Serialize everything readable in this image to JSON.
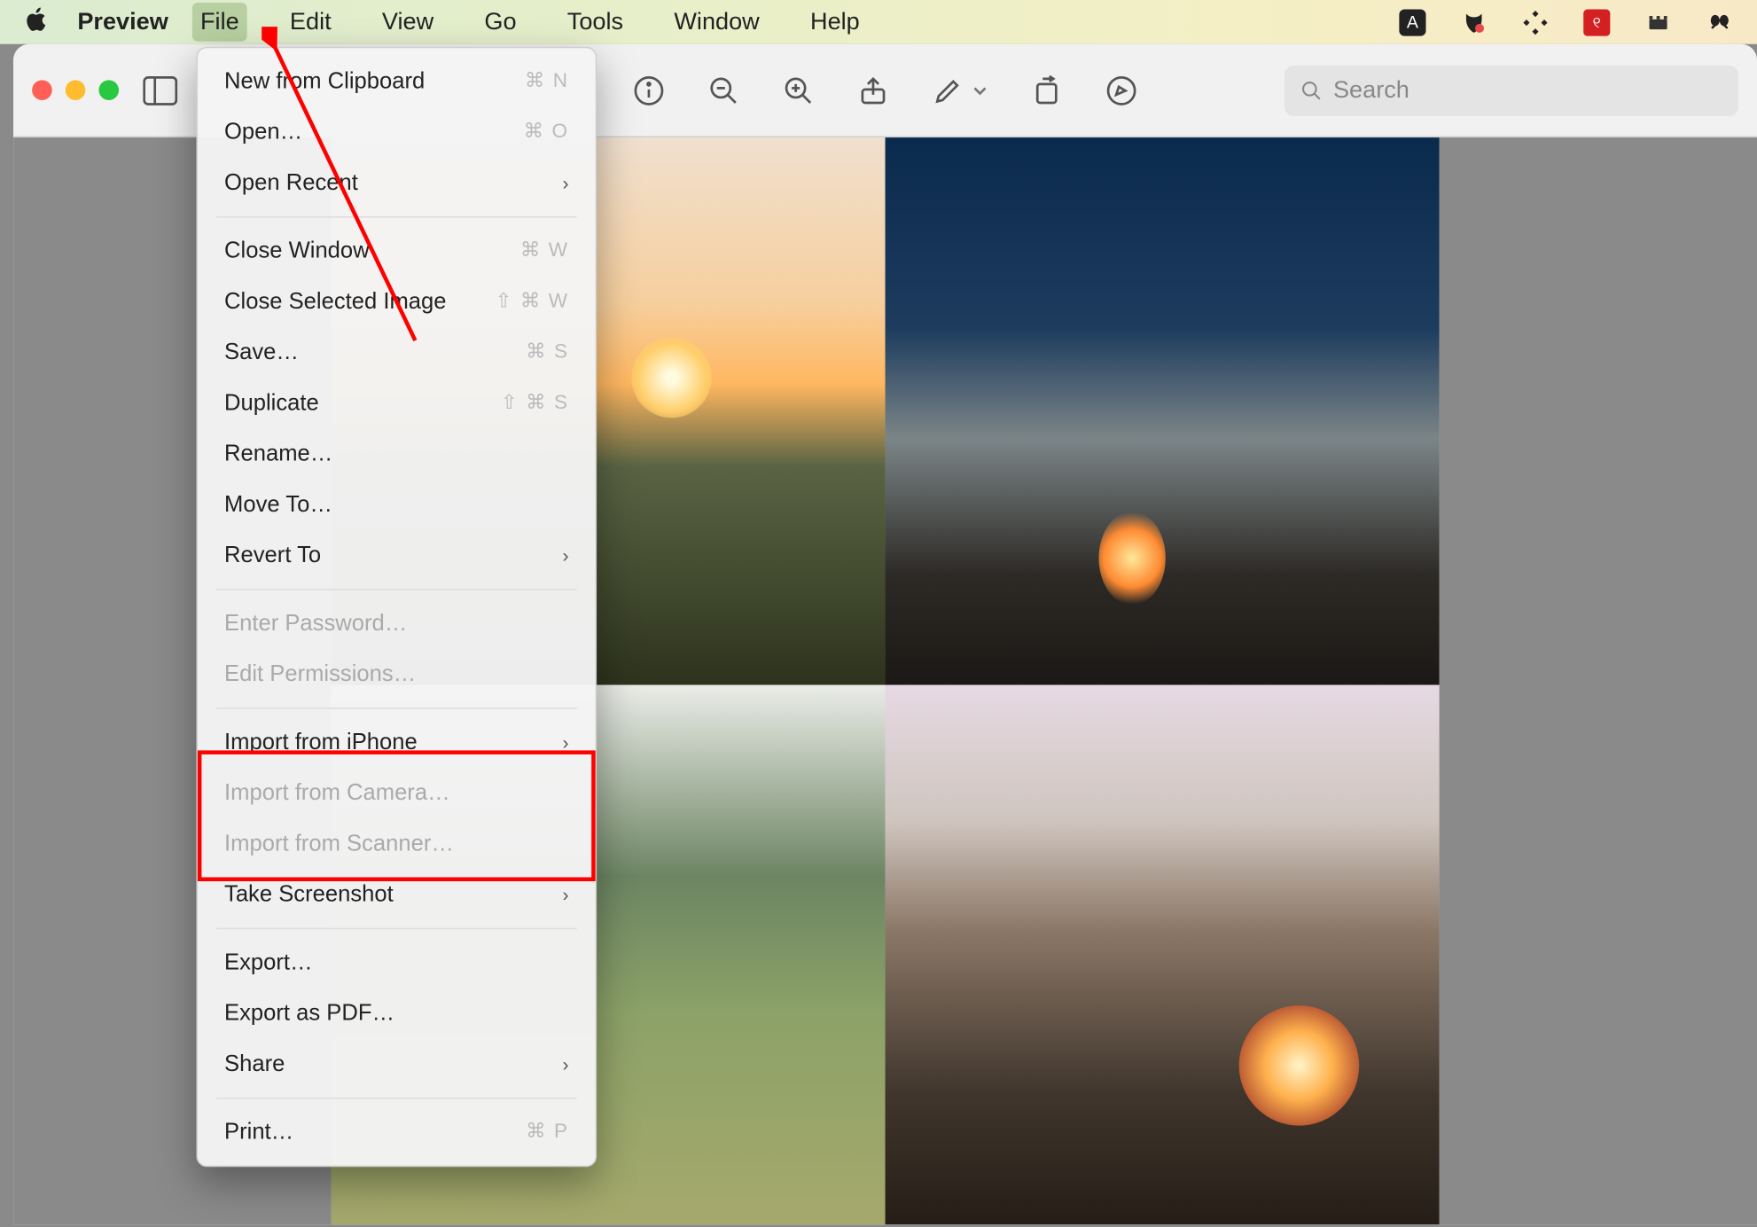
{
  "menubar": {
    "app_name": "Preview",
    "menus": [
      "File",
      "Edit",
      "View",
      "Go",
      "Tools",
      "Window",
      "Help"
    ]
  },
  "tray": {
    "icons": [
      "square-a-icon",
      "malware-icon",
      "cluster-icon",
      "red-square-icon",
      "boxes-icon",
      "binoculars-icon"
    ]
  },
  "toolbar": {
    "search_placeholder": "Search"
  },
  "menu": {
    "new_from_clipboard": "New from Clipboard",
    "new_shortcut": "⌘ N",
    "open": "Open…",
    "open_shortcut": "⌘ O",
    "open_recent": "Open Recent",
    "close_window": "Close Window",
    "close_window_shortcut": "⌘ W",
    "close_selected": "Close Selected Image",
    "close_selected_shortcut": "⇧ ⌘ W",
    "save": "Save…",
    "save_shortcut": "⌘ S",
    "duplicate": "Duplicate",
    "duplicate_shortcut": "⇧ ⌘ S",
    "rename": "Rename…",
    "move_to": "Move To…",
    "revert_to": "Revert To",
    "enter_password": "Enter Password…",
    "edit_permissions": "Edit Permissions…",
    "import_iphone": "Import from iPhone",
    "import_camera": "Import from Camera…",
    "import_scanner": "Import from Scanner…",
    "take_screenshot": "Take Screenshot",
    "export": "Export…",
    "export_pdf": "Export as PDF…",
    "share": "Share",
    "print": "Print…",
    "print_shortcut": "⌘ P"
  }
}
